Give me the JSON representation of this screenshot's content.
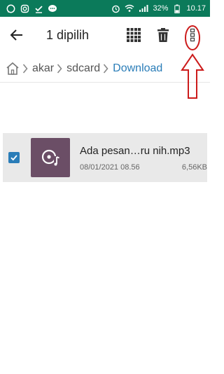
{
  "statusbar": {
    "battery": "32%",
    "time": "10.17"
  },
  "appbar": {
    "title": "1 dipilih"
  },
  "breadcrumb": {
    "items": [
      "akar",
      "sdcard",
      "Download"
    ]
  },
  "file": {
    "name": "Ada pesan…ru nih.mp3",
    "date": "08/01/2021 08.56",
    "size": "6,56KB",
    "selected": true
  },
  "colors": {
    "statusbar": "#0b7a5a",
    "accent": "#2a7db8",
    "thumbnail": "#6b4e66",
    "annotation": "#cc1b1b"
  },
  "icons": {
    "back": "arrow-left-icon",
    "grid": "select-all-grid-icon",
    "delete": "trash-icon",
    "more": "more-vertical-icon",
    "home": "home-icon",
    "music": "music-disc-icon"
  }
}
